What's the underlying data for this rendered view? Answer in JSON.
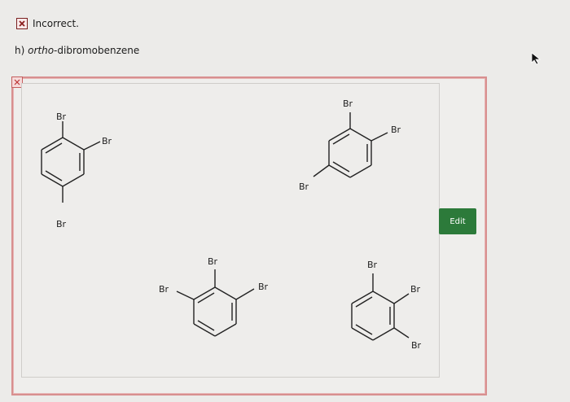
{
  "status": {
    "text": "Incorrect.",
    "icon": "x-icon"
  },
  "question": {
    "prefix": "h) ",
    "italic": "ortho",
    "rest": "-dibromobenzene"
  },
  "panel": {
    "edit_label": "Edit",
    "edit_color": "#2c7a3a",
    "border_color": "#d88f8f"
  },
  "molecules": {
    "m1": {
      "labels": [
        "Br",
        "Br",
        "Br"
      ]
    },
    "m2": {
      "labels": [
        "Br",
        "Br",
        "Br"
      ]
    },
    "m3": {
      "labels": [
        "Br",
        "Br",
        "Br"
      ]
    },
    "m4": {
      "labels": [
        "Br",
        "Br",
        "Br"
      ]
    }
  }
}
